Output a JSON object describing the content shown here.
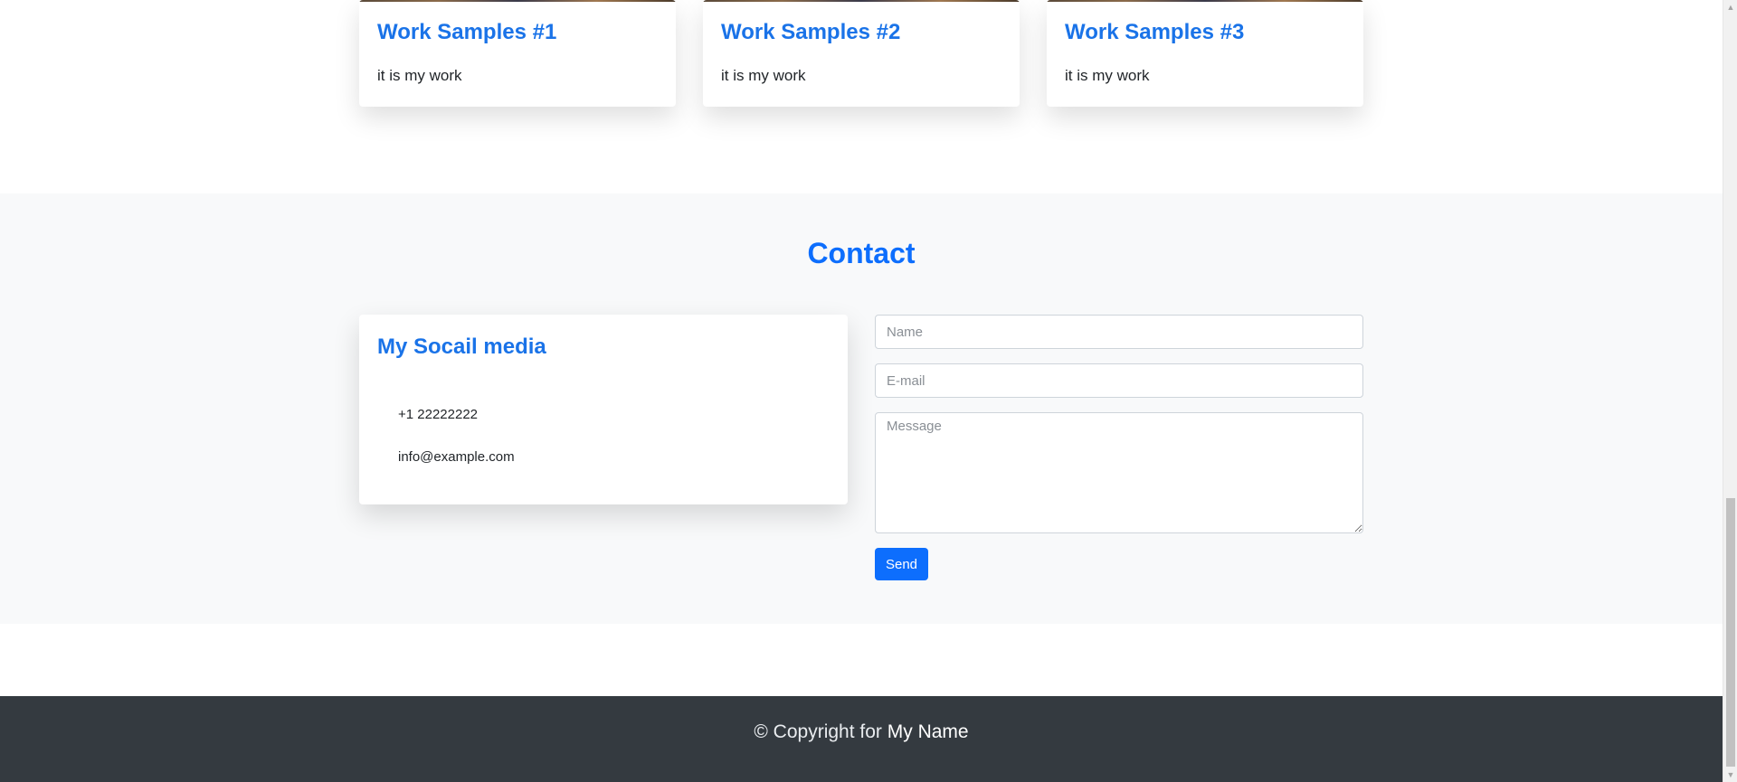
{
  "work": {
    "cards": [
      {
        "title": "Work Samples #1",
        "text": "it is my work"
      },
      {
        "title": "Work Samples #2",
        "text": "it is my work"
      },
      {
        "title": "Work Samples #3",
        "text": "it is my work"
      }
    ]
  },
  "contact": {
    "heading": "Contact",
    "social": {
      "title": "My Socail media",
      "phone": "+1 22222222",
      "email": "info@example.com"
    },
    "form": {
      "name_placeholder": "Name",
      "email_placeholder": "E-mail",
      "message_placeholder": "Message",
      "send_label": "Send"
    }
  },
  "footer": {
    "prefix": "© Copyright for",
    "name": "My Name"
  },
  "colors": {
    "accent": "#0d6efd",
    "contact_bg": "#f8f9fa",
    "footer_bg": "#343a40"
  },
  "scrollbar": {
    "up_icon": "arrow-up-icon",
    "down_icon": "arrow-down-icon"
  }
}
